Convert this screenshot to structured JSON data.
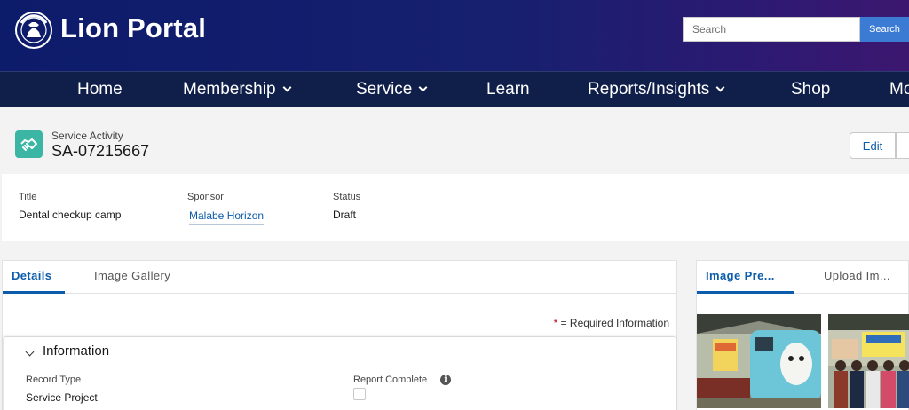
{
  "header": {
    "brand": "Lion Portal",
    "search": {
      "placeholder": "Search",
      "button_label": "Search"
    }
  },
  "nav": {
    "items": [
      {
        "label": "Home",
        "has_dropdown": false
      },
      {
        "label": "Membership",
        "has_dropdown": true
      },
      {
        "label": "Service",
        "has_dropdown": true
      },
      {
        "label": "Learn",
        "has_dropdown": false
      },
      {
        "label": "Reports/Insights",
        "has_dropdown": true
      },
      {
        "label": "Shop",
        "has_dropdown": false
      },
      {
        "label": "Mo",
        "has_dropdown": false
      }
    ]
  },
  "record": {
    "object_type": "Service Activity",
    "id": "SA-07215667",
    "icon": "handshake-icon",
    "icon_color": "#3bb6a4",
    "actions": {
      "edit_label": "Edit"
    }
  },
  "highlights": {
    "title_label": "Title",
    "title_value": "Dental checkup camp",
    "sponsor_label": "Sponsor",
    "sponsor_value": "Malabe Horizon",
    "status_label": "Status",
    "status_value": "Draft"
  },
  "details": {
    "tabs": [
      {
        "label": "Details",
        "active": true
      },
      {
        "label": "Image Gallery",
        "active": false
      }
    ],
    "required_marker": "*",
    "required_text": "= Required Information",
    "section_title": "Information",
    "fields": {
      "record_type_label": "Record Type",
      "record_type_value": "Service Project",
      "report_complete_label": "Report Complete",
      "report_complete_checked": false
    }
  },
  "side_panel": {
    "tabs": [
      {
        "label": "Image Pre...",
        "active": true
      },
      {
        "label": "Upload Im...",
        "active": false
      }
    ]
  },
  "colors": {
    "header_gradient_start": "#0d1b6b",
    "header_gradient_end": "#3c1770",
    "nav_bg": "#0f1f4a",
    "accent": "#0b5cab",
    "search_button": "#3b7bd4"
  }
}
